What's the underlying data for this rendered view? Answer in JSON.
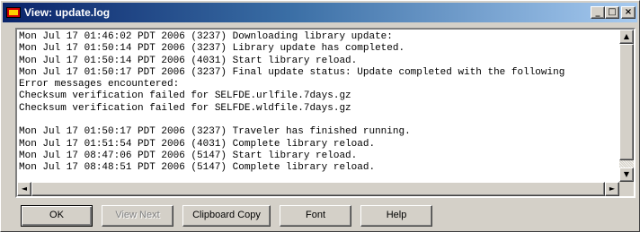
{
  "window": {
    "title": "View: update.log",
    "controls": {
      "minimize": "_",
      "maximize": "□",
      "close": "×"
    }
  },
  "log": {
    "lines": [
      "Mon Jul 17 01:46:02 PDT 2006 (3237) Downloading library update:",
      "Mon Jul 17 01:50:14 PDT 2006 (3237) Library update has completed.",
      "Mon Jul 17 01:50:14 PDT 2006 (4031) Start library reload.",
      "Mon Jul 17 01:50:17 PDT 2006 (3237) Final update status: Update completed with the following",
      "Error messages encountered:",
      "Checksum verification failed for SELFDE.urlfile.7days.gz",
      "Checksum verification failed for SELFDE.wldfile.7days.gz",
      "",
      "Mon Jul 17 01:50:17 PDT 2006 (3237) Traveler has finished running.",
      "Mon Jul 17 01:51:54 PDT 2006 (4031) Complete library reload.",
      "Mon Jul 17 08:47:06 PDT 2006 (5147) Start library reload.",
      "Mon Jul 17 08:48:51 PDT 2006 (5147) Complete library reload."
    ]
  },
  "scrollbar": {
    "up_arrow": "▲",
    "down_arrow": "▼",
    "left_arrow": "◄",
    "right_arrow": "►"
  },
  "buttons": {
    "ok": "OK",
    "view_next": "View Next",
    "clipboard_copy": "Clipboard Copy",
    "font": "Font",
    "help": "Help"
  }
}
